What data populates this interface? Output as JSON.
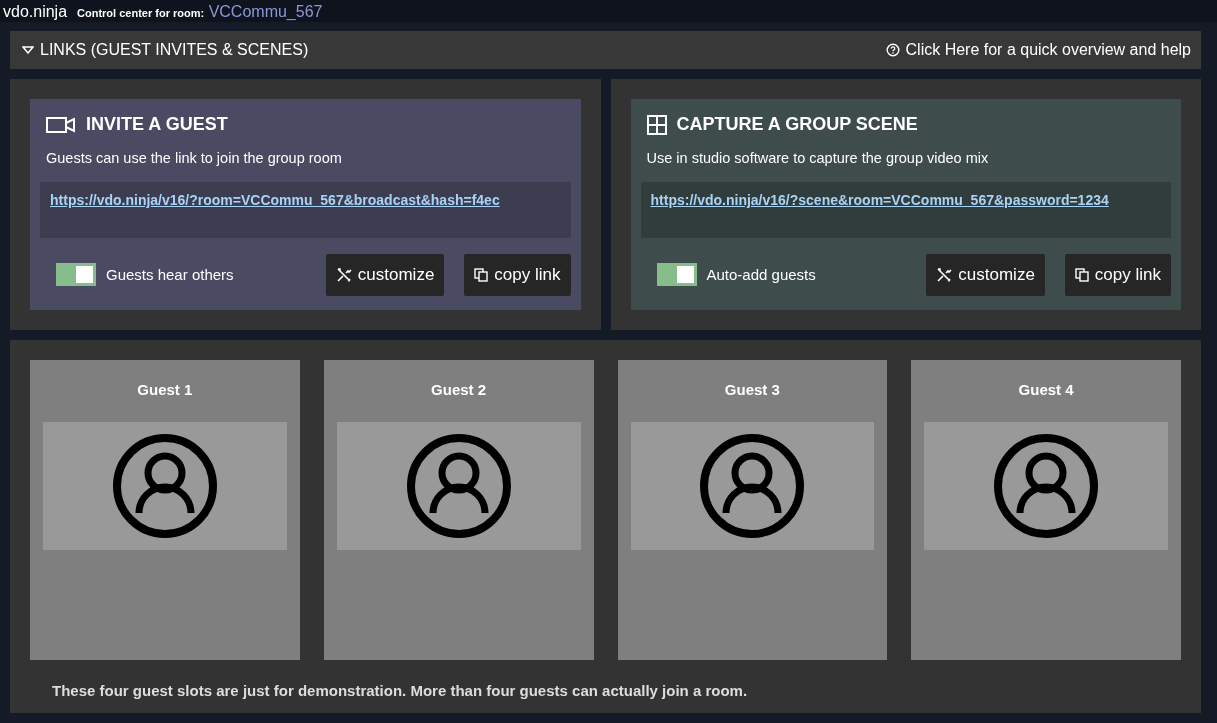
{
  "header": {
    "app_name": "vdo.ninja",
    "room_label": "Control center for room:",
    "room_name": "VCCommu_567"
  },
  "links_bar": {
    "title": "LINKS (GUEST INVITES & SCENES)",
    "expanded": true,
    "help_link": "Click Here for a quick overview and help"
  },
  "link_cards": [
    {
      "kind": "invite",
      "title": "INVITE A GUEST",
      "description": "Guests can use the link to join the group room",
      "url": "https://vdo.ninja/v16/?room=VCCommu_567&broadcast&hash=f4ec",
      "toggle": {
        "label": "Guests hear others",
        "checked": true
      },
      "buttons": [
        "customize",
        "copy link"
      ]
    },
    {
      "kind": "scene",
      "title": "CAPTURE A GROUP SCENE",
      "description": "Use in studio software to capture the group video mix",
      "url": "https://vdo.ninja/v16/?scene&room=VCCommu_567&password=1234",
      "toggle": {
        "label": "Auto-add guests",
        "checked": true
      },
      "buttons": [
        "customize",
        "copy link"
      ]
    }
  ],
  "guest_slots": [
    {
      "name": "Guest 1"
    },
    {
      "name": "Guest 2"
    },
    {
      "name": "Guest 3"
    },
    {
      "name": "Guest 4"
    }
  ],
  "guest_note": "These four guest slots are just for demonstration. More than four guests can actually join a room."
}
